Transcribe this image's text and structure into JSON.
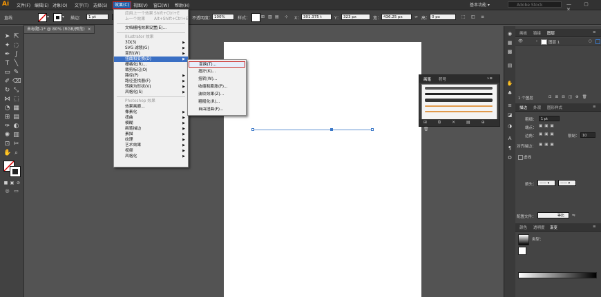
{
  "app": {
    "logo": "Ai"
  },
  "menubar": {
    "items": [
      "文件(F)",
      "编辑(E)",
      "对象(O)",
      "文字(T)",
      "选择(S)",
      "效果(C)",
      "视图(V)",
      "窗口(W)",
      "帮助(H)"
    ],
    "active": "效果(C)",
    "essentials": "基本功能 ▾",
    "search_placeholder": "Adobe Stock",
    "window_controls": "— ▢ ✕"
  },
  "controlbar": {
    "selection_label": "直线",
    "stroke_label": "描边：",
    "stroke_value": "1 pt",
    "opacity_label": "不透明度：",
    "opacity_value": "100%",
    "style_label": "样式：",
    "x_label": "X：",
    "x_value": "301.375 t",
    "y_label": "Y：",
    "y_value": "323 px",
    "w_label": "宽：",
    "w_value": "436.25 px",
    "h_label": "高：",
    "h_value": "0 px"
  },
  "document_tab": {
    "title": "未标题-1* @ 80% (RGB/预览)",
    "close": "×"
  },
  "effect_menu": {
    "items": [
      {
        "label": "应用上一个效果",
        "shortcut": "Shift+Ctrl+E",
        "type": "disabled"
      },
      {
        "label": "上一个效果",
        "shortcut": "Alt+Shift+Ctrl+E",
        "type": "disabled"
      },
      {
        "type": "sep"
      },
      {
        "label": "文档栅格效果设置(E)...",
        "type": "item"
      },
      {
        "type": "sep"
      },
      {
        "label": "Illustrator 效果",
        "type": "header"
      },
      {
        "label": "3D(3)",
        "type": "sub"
      },
      {
        "label": "SVG 滤镜(G)",
        "type": "sub"
      },
      {
        "label": "变形(W)",
        "type": "sub"
      },
      {
        "label": "扭曲和变换(D)",
        "type": "sub",
        "highlight": true
      },
      {
        "label": "栅格化(R)...",
        "type": "item"
      },
      {
        "label": "裁剪标记(O)",
        "type": "item"
      },
      {
        "label": "路径(P)",
        "type": "sub"
      },
      {
        "label": "路径查找器(F)",
        "type": "sub"
      },
      {
        "label": "转换为形状(V)",
        "type": "sub"
      },
      {
        "label": "风格化(S)",
        "type": "sub"
      },
      {
        "type": "sep"
      },
      {
        "label": "Photoshop 效果",
        "type": "header"
      },
      {
        "label": "效果画廊...",
        "type": "item"
      },
      {
        "label": "像素化",
        "type": "sub"
      },
      {
        "label": "扭曲",
        "type": "sub"
      },
      {
        "label": "模糊",
        "type": "sub"
      },
      {
        "label": "画笔描边",
        "type": "sub"
      },
      {
        "label": "素描",
        "type": "sub"
      },
      {
        "label": "纹理",
        "type": "sub"
      },
      {
        "label": "艺术效果",
        "type": "sub"
      },
      {
        "label": "视频",
        "type": "sub"
      },
      {
        "label": "风格化",
        "type": "sub"
      }
    ]
  },
  "distort_submenu": {
    "items": [
      "变换(T)...",
      "扭拧(K)...",
      "扭转(W)...",
      "收缩和膨胀(P)...",
      "波纹效果(Z)...",
      "粗糙化(R)...",
      "自由扭曲(F)..."
    ],
    "highlighted": "变换(T)..."
  },
  "brush_panel": {
    "tabs": [
      "画笔",
      "符号"
    ],
    "footer_icons": "⊞ ⧉ ✕ ▤ ⊕ 🗑"
  },
  "layers_panel": {
    "tabs": [
      "画板",
      "链接",
      "图层"
    ],
    "layer_name": "图层 1",
    "count": "1 个图层"
  },
  "stroke_panel": {
    "tabs": [
      "描边",
      "外观",
      "图形样式"
    ],
    "weight_label": "粗细：",
    "weight_value": "1 pt",
    "cap_label": "端点：",
    "corner_label": "边角：",
    "limit_label": "限制：",
    "limit_value": "10",
    "align_label": "对齐描边：",
    "dashed_label": "虚线",
    "arrow_label": "箭头：",
    "profile_label": "配置文件：",
    "profile_value": "等比"
  },
  "gradient_panel": {
    "tabs": [
      "颜色",
      "透明度",
      "渐变"
    ],
    "type_label": "类型："
  },
  "colors": {
    "accent": "#1f5fa8",
    "highlight_border": "#c82020",
    "path": "#5b8fd0",
    "logo": "#ff9a00"
  }
}
